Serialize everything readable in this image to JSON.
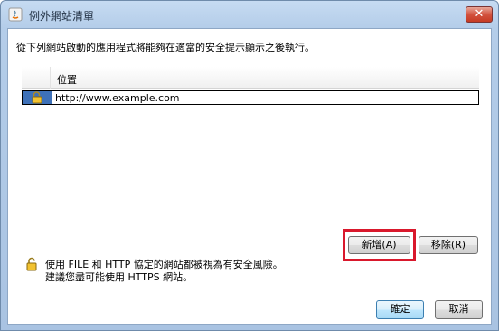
{
  "window": {
    "title": "例外網站清單",
    "close_label": "✕"
  },
  "description": "從下列網站啟動的應用程式將能夠在適當的安全提示顯示之後執行。",
  "table": {
    "columns": [
      "",
      "位置"
    ],
    "rows": [
      {
        "icon": "lock-icon",
        "url": "http://www.example.com"
      }
    ]
  },
  "buttons": {
    "add": "新增(A)",
    "remove": "移除(R)",
    "ok": "確定",
    "cancel": "取消"
  },
  "warning": {
    "line1": "使用 FILE 和 HTTP 協定的網站都被視為有安全風險。",
    "line2": "建議您盡可能使用 HTTPS 網站。"
  },
  "colors": {
    "selection": "#3e71b8",
    "highlight": "#d9182c"
  }
}
